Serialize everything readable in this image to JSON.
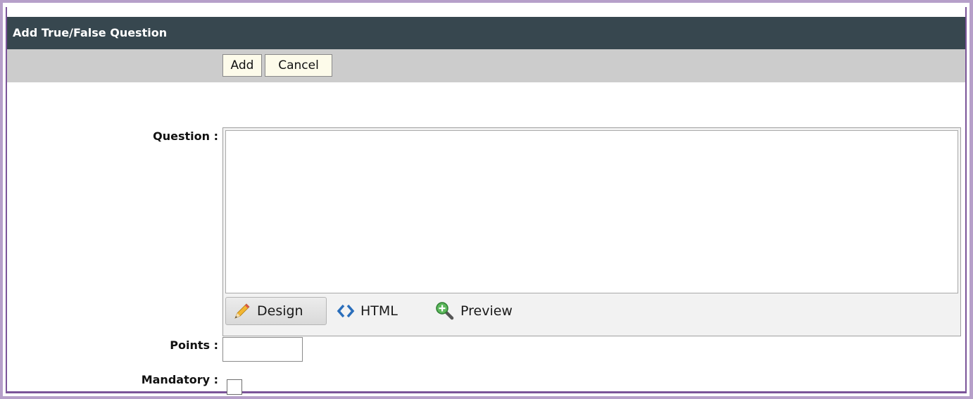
{
  "dialog": {
    "title": "Add True/False Question"
  },
  "toolbar": {
    "add_label": "Add",
    "cancel_label": "Cancel"
  },
  "form": {
    "question_label": "Question :",
    "question_value": "",
    "points_label": "Points :",
    "points_value": "",
    "mandatory_label": "Mandatory :",
    "mandatory_checked": false
  },
  "editor": {
    "modes": [
      {
        "label": "Design",
        "icon": "pencil-icon",
        "active": true
      },
      {
        "label": "HTML",
        "icon": "code-brackets-icon",
        "active": false
      },
      {
        "label": "Preview",
        "icon": "magnifier-plus-icon",
        "active": false
      }
    ]
  },
  "colors": {
    "title_bar": "#37474f",
    "toolbar_bg": "#cccccc",
    "button_bg": "#fdfbea",
    "frame_border": "#7b5499"
  }
}
